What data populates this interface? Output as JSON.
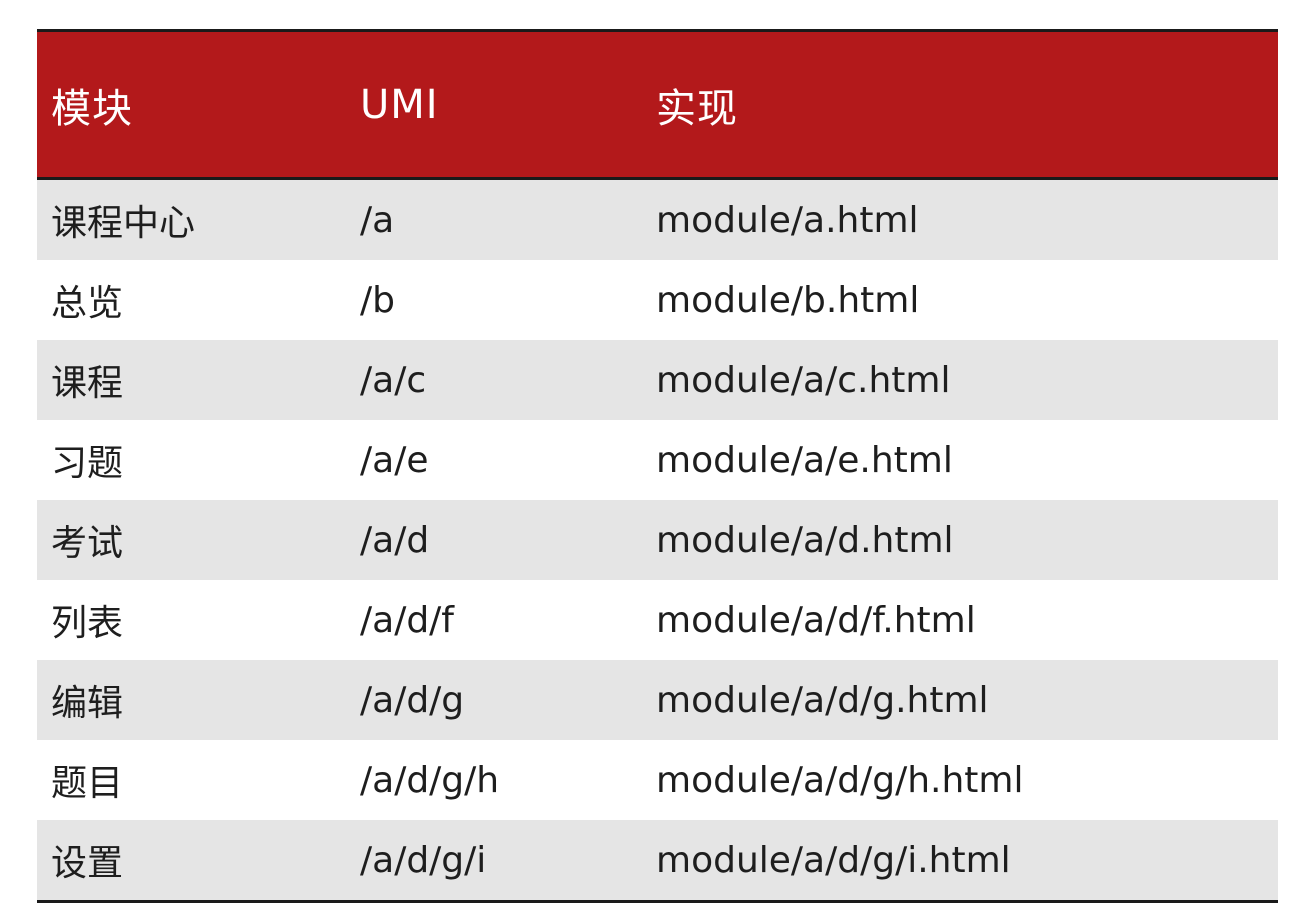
{
  "colors": {
    "header_bg": "#b3191b",
    "header_text": "#ffffff",
    "row_shade": "#e5e5e5",
    "row_plain": "#ffffff",
    "rule": "#1a1a1a"
  },
  "table": {
    "headers": [
      "模块",
      "UMI",
      "实现"
    ],
    "rows": [
      [
        "课程中心",
        "/a",
        "module/a.html"
      ],
      [
        "总览",
        "/b",
        "module/b.html"
      ],
      [
        "课程",
        "/a/c",
        "module/a/c.html"
      ],
      [
        "习题",
        "/a/e",
        "module/a/e.html"
      ],
      [
        "考试",
        "/a/d",
        "module/a/d.html"
      ],
      [
        "列表",
        "/a/d/f",
        "module/a/d/f.html"
      ],
      [
        "编辑",
        "/a/d/g",
        "module/a/d/g.html"
      ],
      [
        "题目",
        "/a/d/g/h",
        "module/a/d/g/h.html"
      ],
      [
        "设置",
        "/a/d/g/i",
        "module/a/d/g/i.html"
      ]
    ]
  }
}
